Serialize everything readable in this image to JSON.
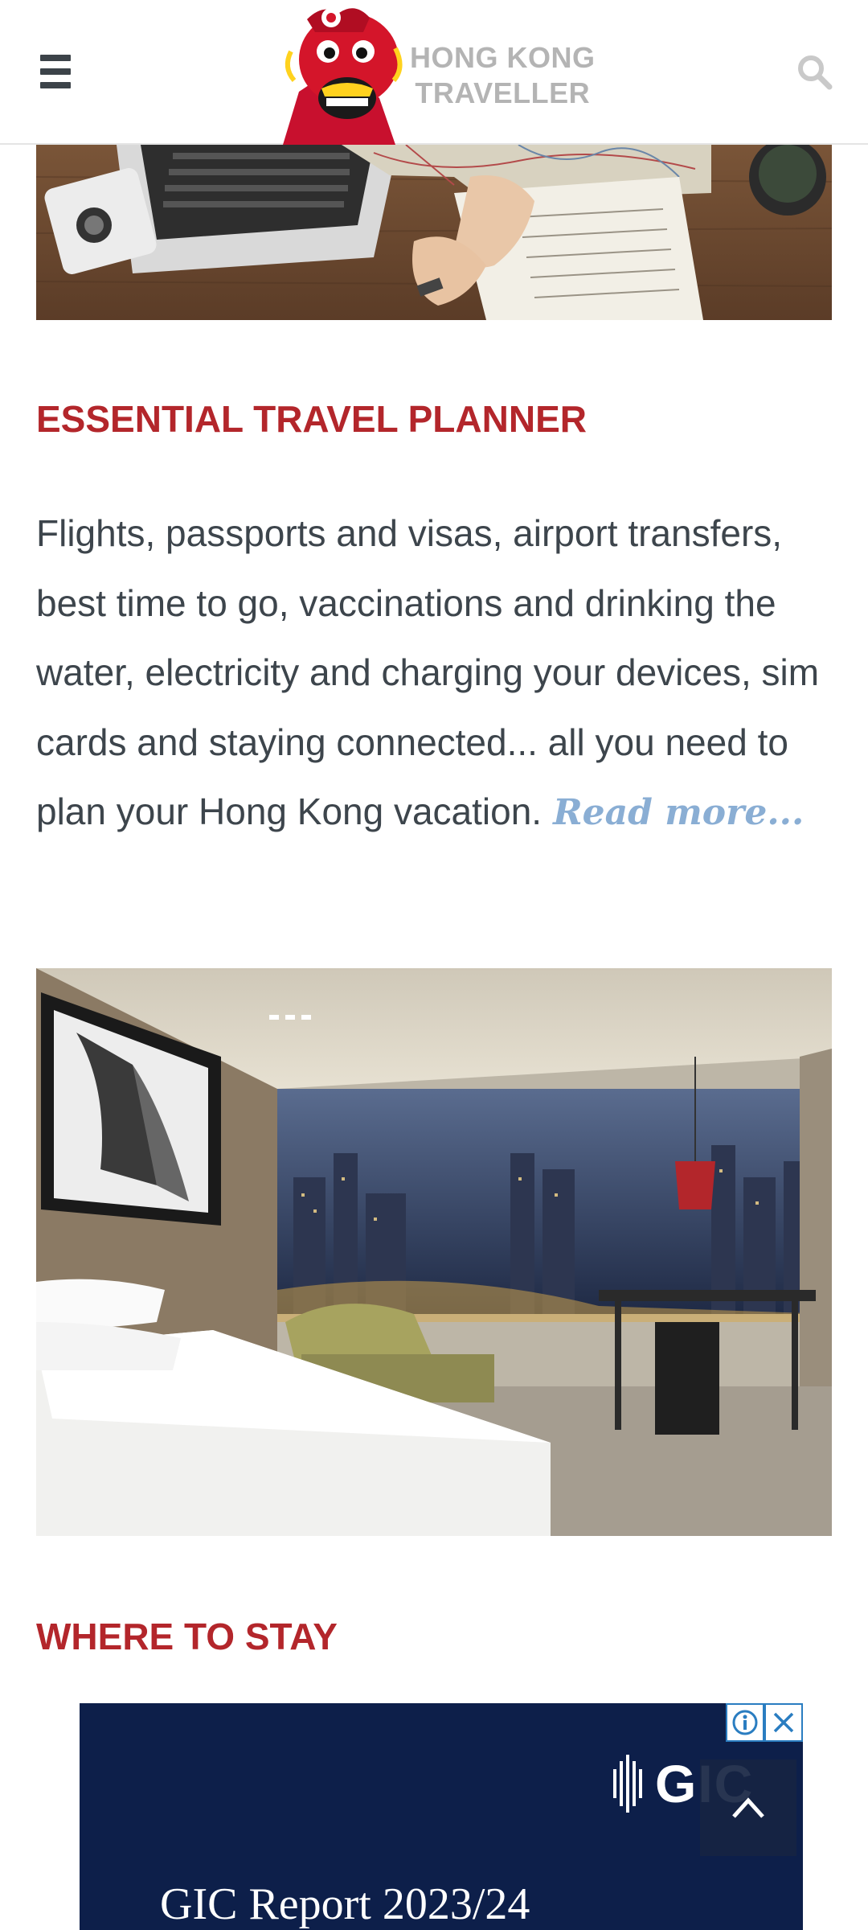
{
  "header": {
    "logo_line1": "HONG KONG",
    "logo_line2": "TRAVELLER",
    "menu_icon": "hamburger-icon",
    "search_icon": "search-icon"
  },
  "sections": [
    {
      "title": "ESSENTIAL TRAVEL PLANNER",
      "body": "Flights, passports and visas, airport transfers, best time to go, vaccinations and drinking the water, electricity and charging your devices, sim cards and staying connected... all you need to plan your Hong Kong vacation.",
      "read_more": "Read more..."
    },
    {
      "title": "WHERE TO STAY"
    }
  ],
  "ad": {
    "brand": "GIC",
    "headline": "GIC Report 2023/24"
  },
  "colors": {
    "accent": "#b3262b",
    "link": "#8aaed4",
    "text": "#3d454c",
    "ad_bg": "#0d1f4a"
  }
}
